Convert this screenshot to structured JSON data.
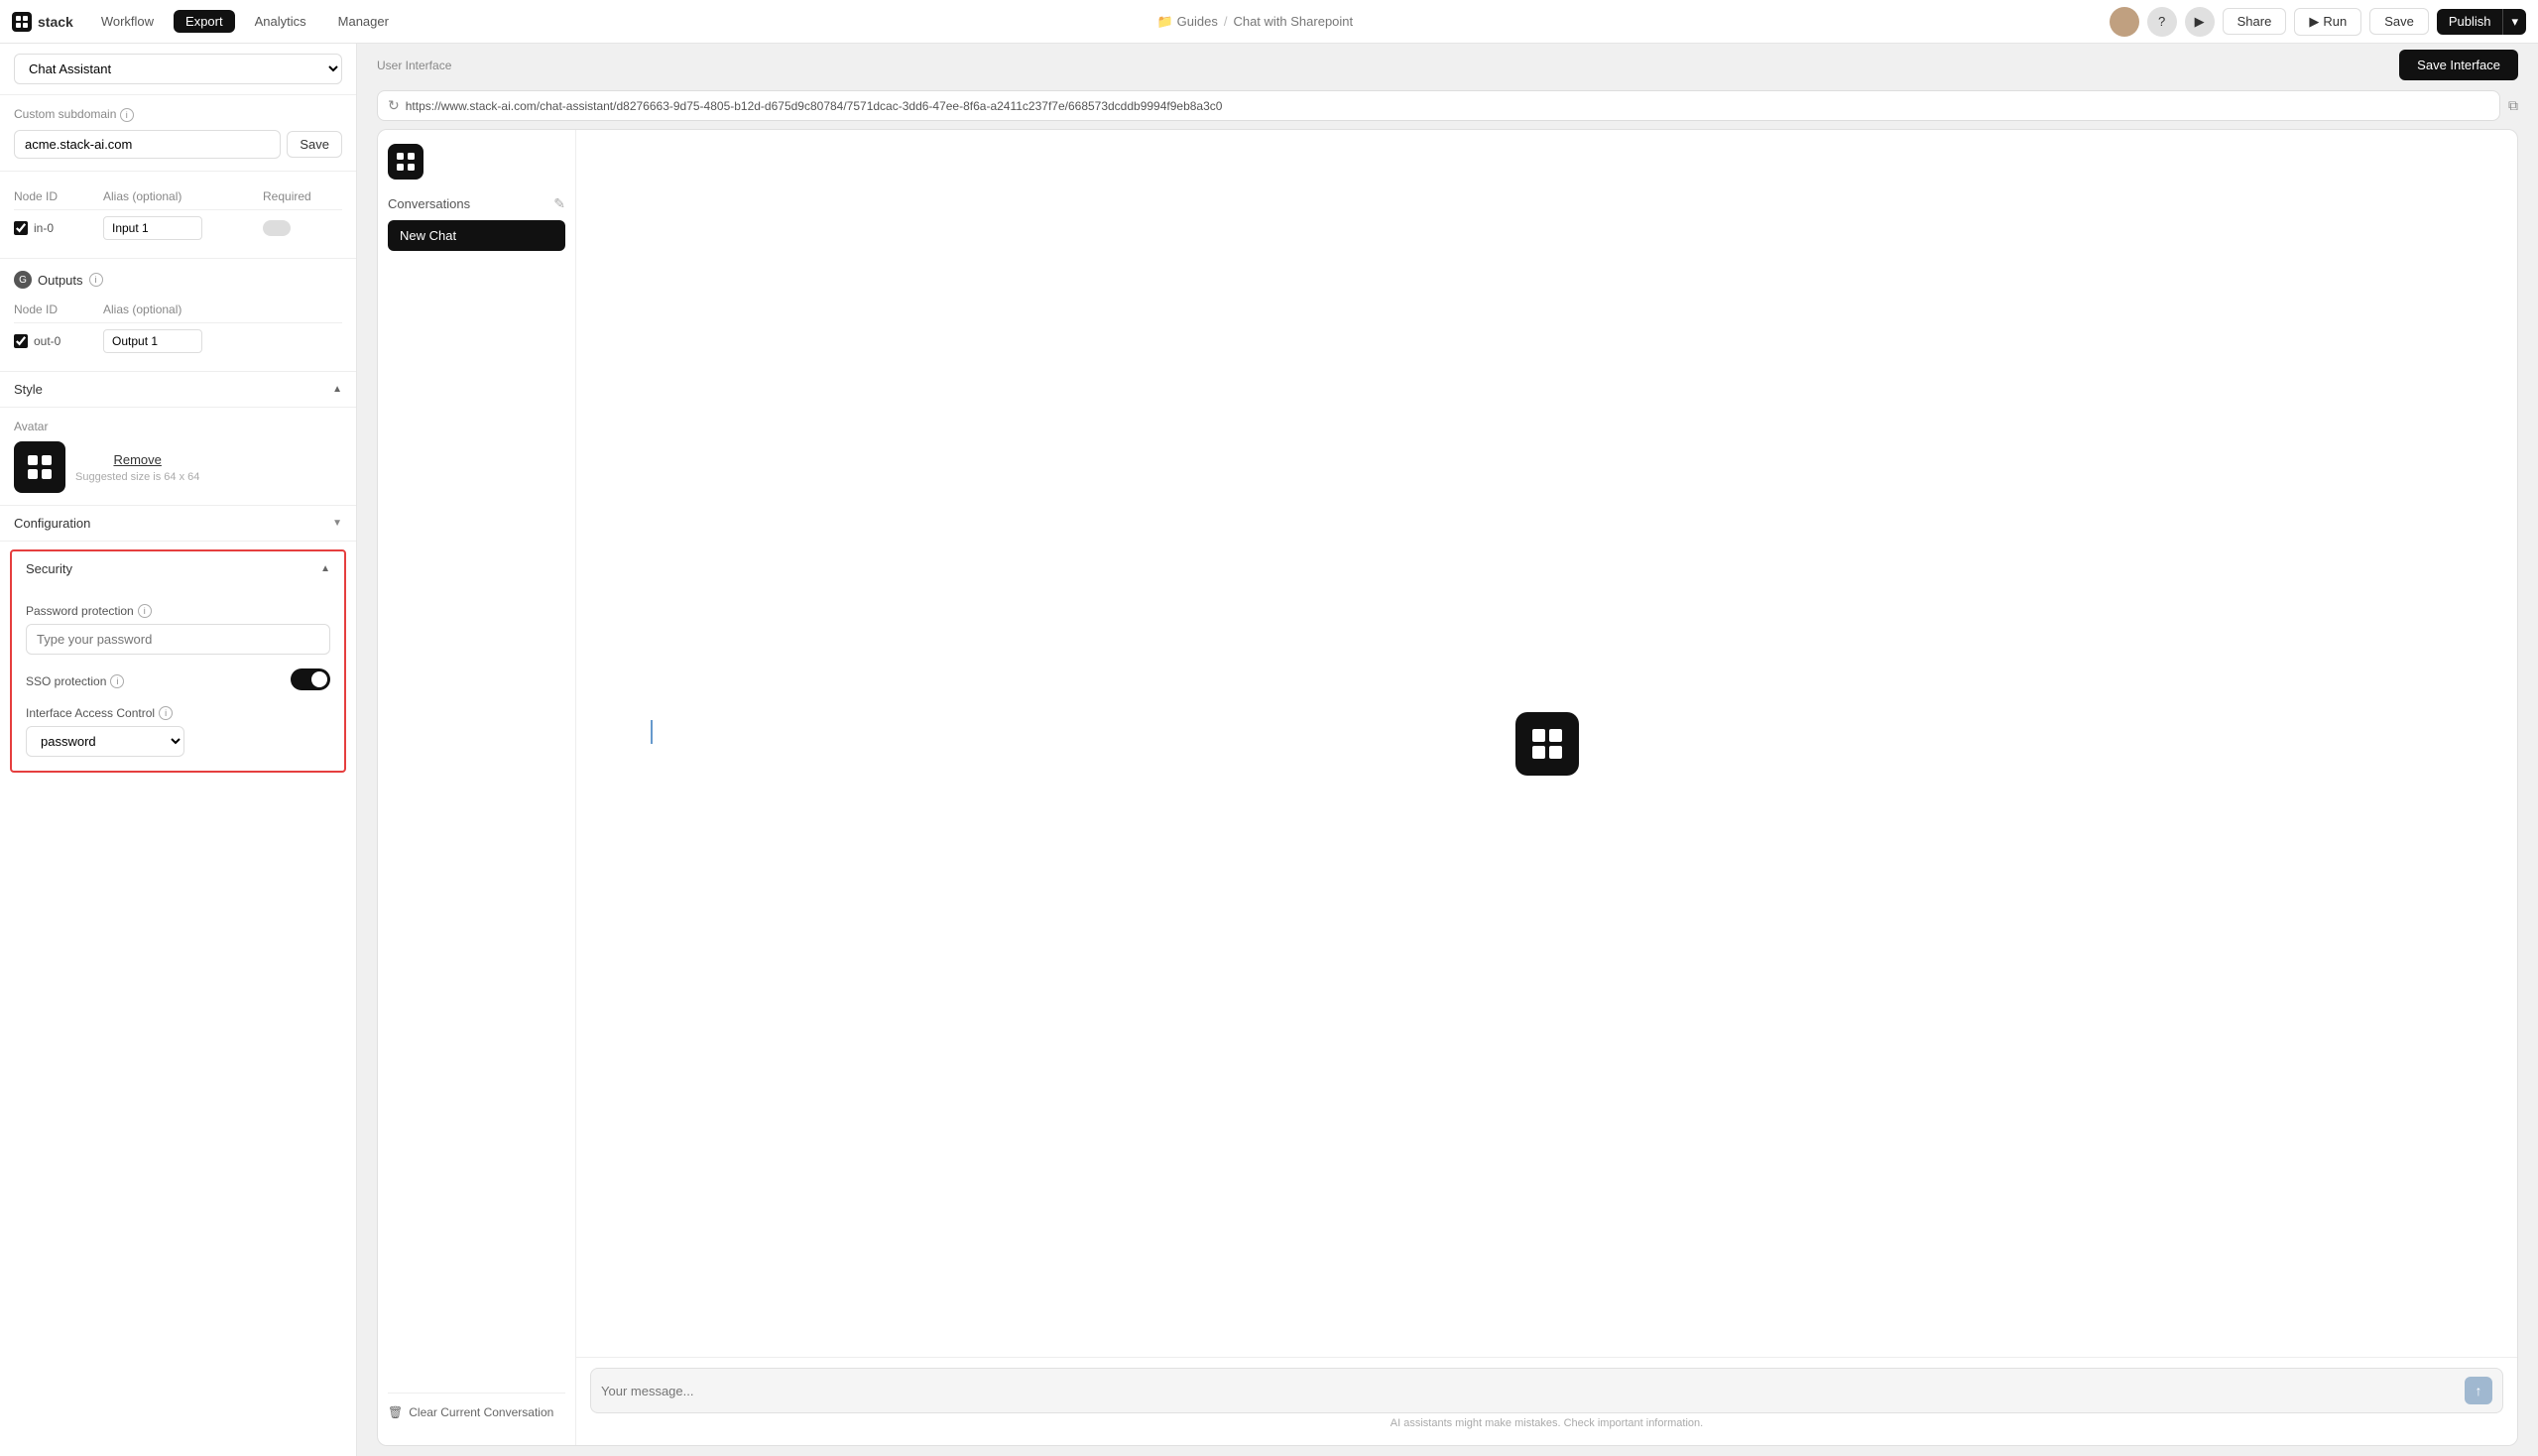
{
  "topnav": {
    "logo_text": "stack",
    "tabs": [
      {
        "label": "Workflow",
        "active": false
      },
      {
        "label": "Export",
        "active": true
      },
      {
        "label": "Analytics",
        "active": false
      },
      {
        "label": "Manager",
        "active": false
      }
    ],
    "breadcrumb": {
      "folder": "Guides",
      "separator": "/",
      "page": "Chat with Sharepoint"
    },
    "buttons": {
      "share": "Share",
      "run": "Run",
      "save": "Save",
      "publish": "Publish"
    }
  },
  "left_panel": {
    "interface_selector": {
      "label": "Chat Assistant",
      "placeholder": "Chat Assistant"
    },
    "custom_subdomain": {
      "label": "Custom subdomain",
      "value": "acme.stack-ai.com",
      "save_label": "Save"
    },
    "inputs_table": {
      "columns": [
        "Node ID",
        "Alias (optional)",
        "Required"
      ],
      "rows": [
        {
          "node_id": "in-0",
          "alias": "Input 1",
          "required": false,
          "checked": true
        }
      ]
    },
    "outputs": {
      "label": "Outputs",
      "columns": [
        "Node ID",
        "Alias (optional)"
      ],
      "rows": [
        {
          "node_id": "out-0",
          "alias": "Output 1",
          "checked": true
        }
      ]
    },
    "style": {
      "label": "Style",
      "avatar": {
        "label": "Avatar",
        "remove_label": "Remove",
        "hint": "Suggested size is 64 x 64"
      }
    },
    "configuration": {
      "label": "Configuration"
    },
    "security": {
      "label": "Security",
      "password_protection": {
        "label": "Password protection",
        "placeholder": "Type your password"
      },
      "sso_protection": {
        "label": "SSO protection",
        "enabled": true
      },
      "interface_access_control": {
        "label": "Interface Access Control",
        "value": "password"
      }
    }
  },
  "preview": {
    "label": "User Interface",
    "save_interface_label": "Save Interface",
    "url": "https://www.stack-ai.com/chat-assistant/d8276663-9d75-4805-b12d-d675d9c80784/7571dcac-3dd6-47ee-8f6a-a2411c237f7e/668573dcddb9994f9eb8a3c0",
    "chat": {
      "conversations_label": "Conversations",
      "new_chat_label": "New Chat",
      "clear_conversation_label": "Clear Current Conversation",
      "input_placeholder": "Your message...",
      "disclaimer": "AI assistants might make mistakes. Check important information."
    }
  }
}
